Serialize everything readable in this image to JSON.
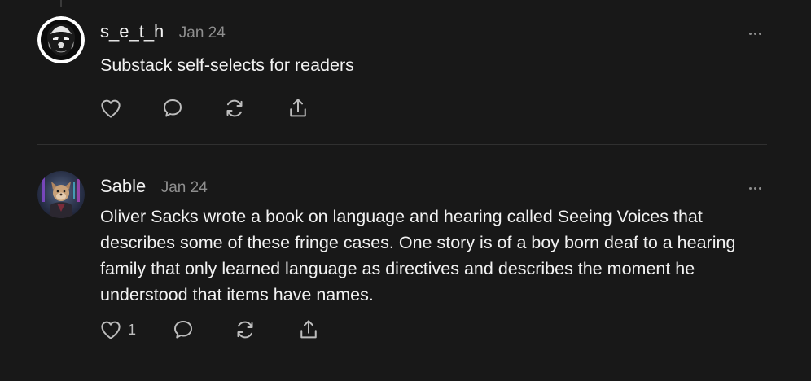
{
  "comments": [
    {
      "author": "s_e_t_h",
      "date": "Jan 24",
      "avatar": "lion-face-avatar",
      "text": "Substack self-selects for readers",
      "like_count": "",
      "actions": [
        "heart-icon",
        "comment-icon",
        "restack-icon",
        "share-icon"
      ]
    },
    {
      "author": "Sable",
      "date": "Jan 24",
      "avatar": "illustrated-character-avatar",
      "text": "Oliver Sacks wrote a book on language and hearing called Seeing Voices that describes some of these fringe cases. One story is of a boy born deaf to a hearing family that only learned language as directives and describes the moment he understood that items have names.",
      "like_count": "1",
      "actions": [
        "heart-icon",
        "comment-icon",
        "restack-icon",
        "share-icon"
      ]
    }
  ],
  "colors": {
    "background": "#181818",
    "text": "#f2f2f2",
    "muted": "#8e8e8e",
    "icon": "#bdbdbd",
    "divider": "#303030"
  }
}
